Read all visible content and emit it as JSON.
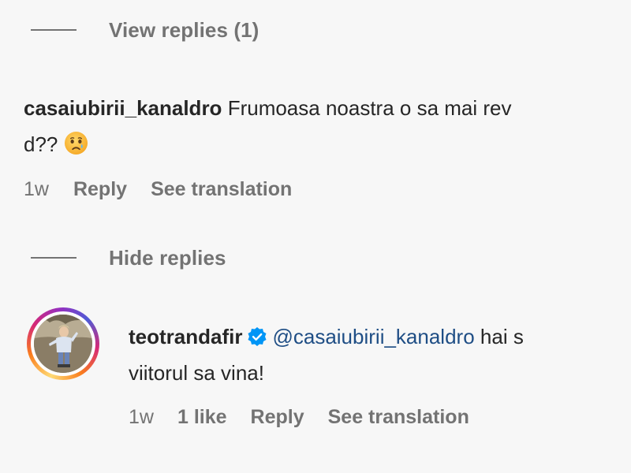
{
  "thread": {
    "view_replies_label": "View replies (1)",
    "hide_replies_label": "Hide replies"
  },
  "comment1": {
    "username": "casaiubirii_kanaldro",
    "text_line1": "Frumoasa noastra o sa mai rev",
    "text_line2": "d??",
    "emoji": "sad-tear-emoji",
    "time": "1w",
    "reply_label": "Reply",
    "translate_label": "See translation"
  },
  "comment2": {
    "username": "teotrandafir",
    "verified": true,
    "mention": "@casaiubirii_kanaldro",
    "text_line1": "hai s",
    "text_line2": "viitorul sa vina!",
    "time": "1w",
    "likes": "1 like",
    "reply_label": "Reply",
    "translate_label": "See translation"
  },
  "colors": {
    "background": "#f7f7f7",
    "text": "#262626",
    "secondary": "#737373",
    "mention": "#1f4e85",
    "verified": "#0095f6"
  }
}
